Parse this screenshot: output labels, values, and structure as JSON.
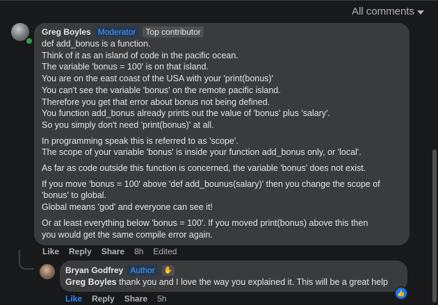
{
  "header": {
    "filter_label": "All comments"
  },
  "comment": {
    "author": "Greg Boyles",
    "badges": {
      "moderator": "Moderator",
      "top": "Top contributor"
    },
    "paragraphs": [
      {
        "lines": [
          "def add_bonus is a function.",
          "Think of it as an island of code in the pacific ocean.",
          "The variable 'bonus = 100' is on that island.",
          "You are on the east coast of the USA with your 'print(bonus)'",
          "You can't see the variable 'bonus' on the remote pacific island.",
          "Therefore you get that error about bonus not being defined.",
          "You function add_bonus already prints out the value of 'bonus' plus 'salary'.",
          "So you simply don't need 'print(bonus)' at all."
        ]
      },
      {
        "lines": [
          "In programming speak this is referred to as 'scope'.",
          "The scope of your variable 'bonus' is inside your function add_bonus only, or 'local'."
        ]
      },
      {
        "lines": [
          "As far as code outside this function is concerned, the variable 'bonus' does not exist."
        ]
      },
      {
        "lines": [
          "If you move 'bonus = 100' above 'def add_bounus(salary)' then you change the scope of",
          "'bonus' to global.",
          "Global means 'god' and everyone can see it!"
        ]
      },
      {
        "lines": [
          "Or at least everything below 'bonus = 100'. If you moved print(bonus) above this then",
          "you would get the same compile error again."
        ]
      }
    ],
    "actions": {
      "like": "Like",
      "reply": "Reply",
      "share": "Share",
      "time": "8h",
      "edited": "Edited"
    }
  },
  "reply": {
    "author": "Bryan Godfrey",
    "badge": "Author",
    "mention": "Greg Boyles",
    "text": " thank you and I love the way you explained it. This will be a great help",
    "actions": {
      "like": "Like",
      "reply": "Reply",
      "share": "Share",
      "time": "5h"
    }
  },
  "colors": {
    "background": "#18191a",
    "bubble": "#3a3b3c",
    "accent": "#2d88ff",
    "online": "#31a24c"
  }
}
